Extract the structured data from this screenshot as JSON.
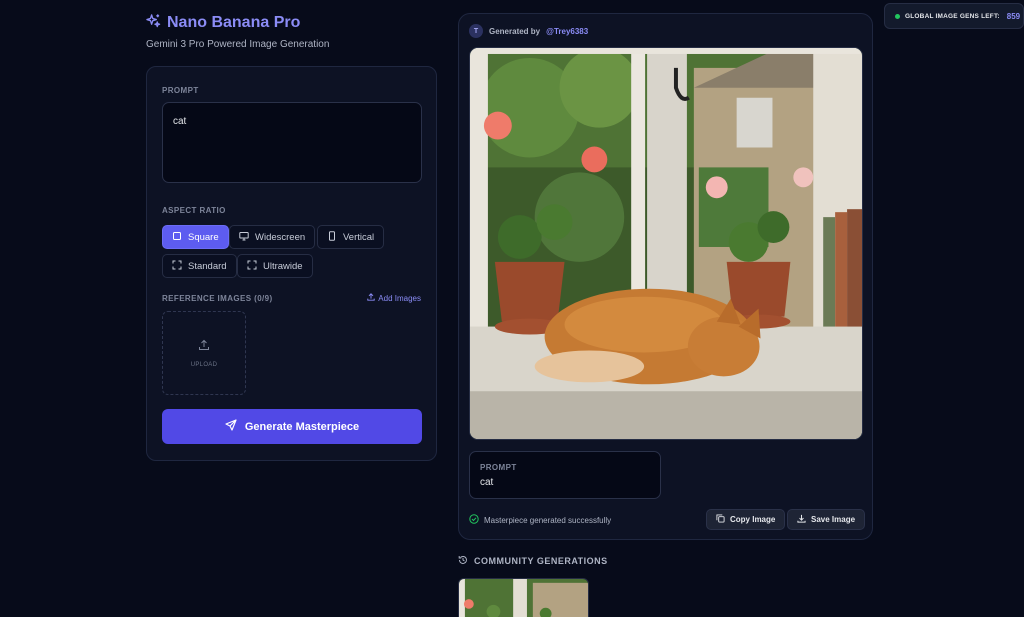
{
  "header": {
    "title": "Nano Banana Pro",
    "subtitle": "Gemini 3 Pro Powered Image Generation",
    "logo_icon": "sparkles-icon"
  },
  "form": {
    "prompt_label": "PROMPT",
    "prompt_value": "cat",
    "aspect_label": "ASPECT RATIO",
    "aspect_options": [
      {
        "label": "Square",
        "icon": "square-icon",
        "active": true
      },
      {
        "label": "Widescreen",
        "icon": "monitor-icon",
        "active": false
      },
      {
        "label": "Vertical",
        "icon": "phone-icon",
        "active": false
      },
      {
        "label": "Standard",
        "icon": "expand-icon",
        "active": false
      },
      {
        "label": "Ultrawide",
        "icon": "expand-icon",
        "active": false
      }
    ],
    "reference_label": "REFERENCE IMAGES (0/9)",
    "add_images_label": "Add Images",
    "upload_label": "UPLOAD",
    "generate_label": "Generate Masterpiece"
  },
  "result": {
    "avatar_initial": "T",
    "generated_by": "Generated by",
    "handle": "@Trey6383",
    "prompt_label": "PROMPT",
    "prompt_value": "cat",
    "status": "Masterpiece generated successfully",
    "copy_label": "Copy Image",
    "save_label": "Save Image"
  },
  "community": {
    "title": "COMMUNITY GENERATIONS"
  },
  "counter": {
    "label": "GLOBAL IMAGE GENS LEFT:",
    "value": "859"
  },
  "colors": {
    "background": "#070b1a",
    "accent": "#5d5cf0",
    "accent_text": "#8b8cf6",
    "success": "#22c55e"
  }
}
